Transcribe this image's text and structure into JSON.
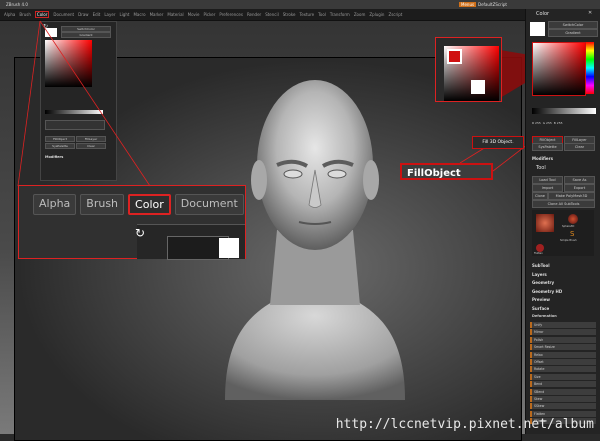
{
  "title": {
    "app_title": "ZBrush 4.0",
    "menu_toggle": "Menus",
    "script": "DefaultZScript"
  },
  "menu": {
    "items": [
      "Alpha",
      "Brush",
      "Color",
      "Document",
      "Draw",
      "Edit",
      "Layer",
      "Light",
      "Macro",
      "Marker",
      "Material",
      "Movie",
      "Picker",
      "Preferences",
      "Render",
      "Stencil",
      "Stroke",
      "Texture",
      "Tool",
      "Transform",
      "Zoom",
      "Zplugin",
      "Zscript"
    ],
    "active": "Color"
  },
  "left_palette": {
    "switch_color": "SwitchColor",
    "gradient": "Gradient",
    "fill_object": "FillObject",
    "fill_layer": "FillLayer",
    "sys_palette": "SysPalette",
    "clear": "Clear",
    "modifiers": "Modifiers"
  },
  "zoom_menu": {
    "tabs": [
      "Alpha",
      "Brush",
      "Color",
      "Document"
    ],
    "active": "Color"
  },
  "callouts": {
    "fill_small": "Fill 3D Object.",
    "fill_large": "FillObject"
  },
  "right_panel": {
    "color_title": "Color",
    "switch_color": "SwitchColor",
    "gradient": "Gradient",
    "r_val": "R 255",
    "g_val": "G 255",
    "b_val": "B 255",
    "fill_object": "FillObject",
    "fill_layer": "FillLayer",
    "sys_palette": "SysPalette",
    "clear": "Clear",
    "modifiers": "Modifiers",
    "tool_title": "Tool",
    "load_tool": "Load Tool",
    "save_as": "Save As",
    "import": "Import",
    "export": "Export",
    "clone": "Clone",
    "make_polymesh": "Make PolyMesh3D",
    "clone_all": "Clone All SubTools",
    "thumbs": [
      "Sphere3D",
      "Simple Brush",
      "Flatten"
    ],
    "sections": [
      "SubTool",
      "Layers",
      "Geometry",
      "Geometry HD",
      "Preview",
      "Surface"
    ],
    "deformation_title": "Deformation",
    "sliders": [
      "Unify",
      "Mirror",
      "Polish",
      "Smart Resize",
      "Relax",
      "Offset",
      "Rotate",
      "Size",
      "Bend",
      "SBend",
      "Skew",
      "SSkew",
      "Flatten",
      "SFlatten"
    ]
  },
  "watermark": "http://lccnetvip.pixnet.net/album",
  "colors": {
    "accent_red": "#d22222",
    "slider_orange": "#b96a1e",
    "menu_button": "#d0701a"
  }
}
